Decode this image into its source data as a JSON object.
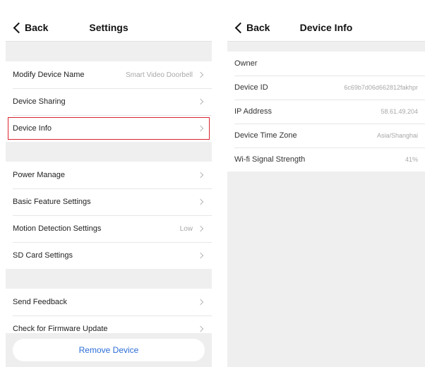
{
  "left": {
    "nav": {
      "back": "Back",
      "title": "Settings"
    },
    "group1": [
      {
        "label": "Modify Device Name",
        "value": "Smart Video Doorbell"
      },
      {
        "label": "Device Sharing",
        "value": ""
      },
      {
        "label": "Device Info",
        "value": ""
      }
    ],
    "group2": [
      {
        "label": "Power Manage",
        "value": ""
      },
      {
        "label": "Basic Feature Settings",
        "value": ""
      },
      {
        "label": "Motion Detection Settings",
        "value": "Low"
      },
      {
        "label": "SD Card Settings",
        "value": ""
      }
    ],
    "group3": [
      {
        "label": "Send Feedback",
        "value": ""
      },
      {
        "label": "Check for Firmware Update",
        "value": ""
      }
    ],
    "remove_button": "Remove Device"
  },
  "right": {
    "nav": {
      "back": "Back",
      "title": "Device Info"
    },
    "rows": [
      {
        "label": "Owner",
        "value": ""
      },
      {
        "label": "Device ID",
        "value": "6c69b7d06d662812fakhpr"
      },
      {
        "label": "IP Address",
        "value": "58.61.49.204"
      },
      {
        "label": "Device Time Zone",
        "value": "Asia/Shanghai"
      },
      {
        "label": "Wi-fi Signal Strength",
        "value": "41%"
      }
    ]
  },
  "colors": {
    "accent_blue": "#2d6ed8",
    "highlight_red": "#d9262f",
    "group_gap": "#efefef"
  }
}
